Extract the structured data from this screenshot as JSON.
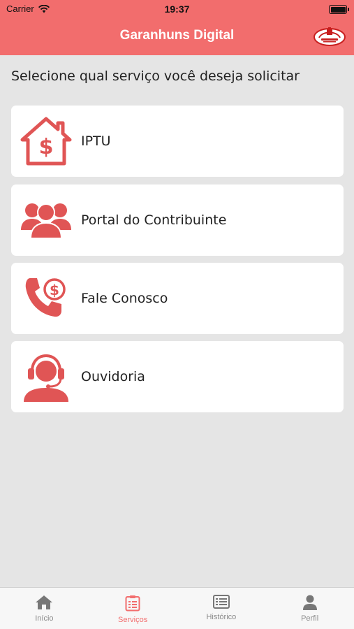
{
  "status_bar": {
    "carrier": "Carrier",
    "time": "19:37"
  },
  "header": {
    "title": "Garanhuns Digital"
  },
  "prompt": "Selecione qual serviço você deseja solicitar",
  "services": [
    {
      "label": "IPTU",
      "icon": "house-dollar-icon"
    },
    {
      "label": "Portal do Contribuinte",
      "icon": "people-group-icon"
    },
    {
      "label": "Fale Conosco",
      "icon": "phone-dollar-icon"
    },
    {
      "label": "Ouvidoria",
      "icon": "headset-agent-icon"
    }
  ],
  "tabbar": {
    "items": [
      {
        "label": "Início",
        "icon": "home-icon"
      },
      {
        "label": "Serviços",
        "icon": "clipboard-list-icon"
      },
      {
        "label": "Histórico",
        "icon": "list-icon"
      },
      {
        "label": "Perfil",
        "icon": "person-icon"
      }
    ],
    "active": "Serviços"
  },
  "colors": {
    "accent": "#f26d6d",
    "background": "#e5e5e5",
    "icon_red": "#e05555",
    "inactive": "#8a8a8a"
  }
}
